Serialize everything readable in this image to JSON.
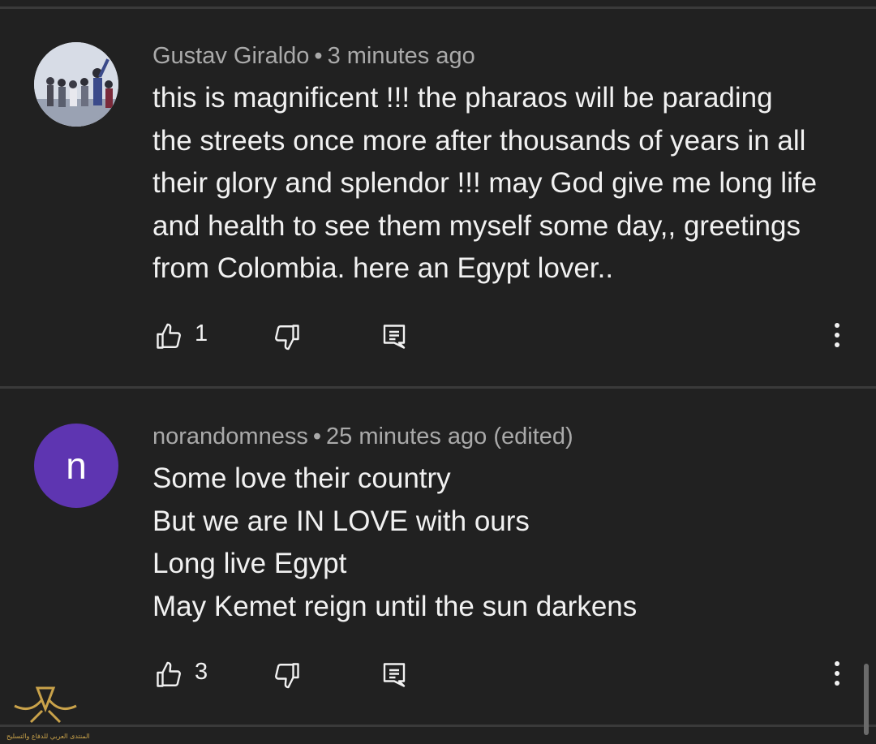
{
  "comments": [
    {
      "author": "Gustav Giraldo",
      "separator": "•",
      "time": "3 minutes ago",
      "edited": "",
      "avatar": {
        "type": "photo",
        "icon": "user-photo-avatar"
      },
      "lines": [
        "this is magnificent !!!  the pharaos will be parading",
        "the streets once more after thousands of years in all",
        "their glory and splendor !!! may God give me long life",
        "and health to see them myself some day,, greetings",
        "from Colombia. here an Egypt lover.."
      ],
      "likes": "1"
    },
    {
      "author": "norandomness",
      "separator": "•",
      "time": "25 minutes ago",
      "edited": "(edited)",
      "avatar": {
        "type": "letter",
        "letter": "n",
        "color": "#5e35b1"
      },
      "lines": [
        "Some love their country",
        "But we are IN LOVE with ours",
        "Long live Egypt",
        "May Kemet reign until the sun darkens"
      ],
      "likes": "3"
    }
  ],
  "icons": {
    "like": "thumbs-up-icon",
    "dislike": "thumbs-down-icon",
    "reply": "reply-icon",
    "more": "more-vertical-icon"
  },
  "watermark": {
    "caption": "المنتدى العربي للدفاع والتسليح"
  },
  "colors": {
    "background": "#212121",
    "text": "#f1f1f1",
    "meta": "#aaaaaa",
    "divider": "#3a3a3a",
    "avatar_letter_bg": "#5e35b1"
  }
}
